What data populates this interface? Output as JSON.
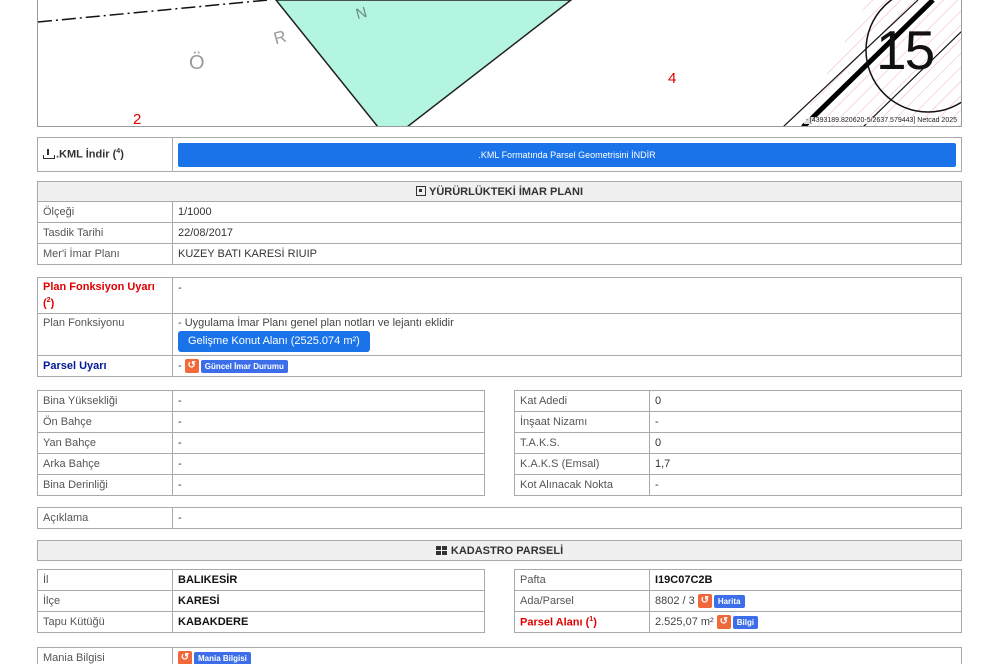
{
  "map": {
    "labels": {
      "o": "Ö",
      "r": "R",
      "n": "N",
      "parcel_2": "2",
      "parcel_4": "4",
      "sheet": "15"
    },
    "attribution": "- [4393189.820620-5/2637.579443] Netcad 2025",
    "colors": {
      "parcel_fill": "#b3f5e1",
      "hatch": "#f3b1b1"
    }
  },
  "kml": {
    "label": ".KML İndir (",
    "label_sup": "4",
    "label_end": ")",
    "button": ".KML Formatında Parsel Geometrisini İNDİR"
  },
  "imar": {
    "title": "YÜRÜRLÜKTEKİ İMAR PLANI",
    "rows": [
      {
        "label": "Ölçeği",
        "value": "1/1000"
      },
      {
        "label": "Tasdik Tarihi",
        "value": "22/08/2017"
      },
      {
        "label": "Mer'i İmar Planı",
        "value": "KUZEY BATI KARESİ RIUIP"
      }
    ]
  },
  "fonksiyon": {
    "warn_label": "Plan Fonksiyon Uyarı (",
    "warn_sup": "2",
    "warn_end": ")",
    "warn_value": "-",
    "label": "Plan Fonksiyonu",
    "note": "- Uygulama İmar Planı genel plan notları ve lejantı eklidir",
    "button": "Gelişme Konut Alanı (2525.074 m²)",
    "parsel_label": "Parsel Uyarı",
    "parsel_dash": "-",
    "parsel_button": "Güncel İmar Durumu"
  },
  "yapi_left": [
    {
      "label": "Bina Yüksekliği",
      "value": "-"
    },
    {
      "label": "Ön Bahçe",
      "value": "-"
    },
    {
      "label": "Yan Bahçe",
      "value": "-"
    },
    {
      "label": "Arka Bahçe",
      "value": "-"
    },
    {
      "label": "Bina Derinliği",
      "value": "-"
    }
  ],
  "yapi_right": [
    {
      "label": "Kat Adedi",
      "value": "0"
    },
    {
      "label": "İnşaat Nizamı",
      "value": "-"
    },
    {
      "label": "T.A.K.S.",
      "value": "0"
    },
    {
      "label": "K.A.K.S (Emsal)",
      "value": "1,7"
    },
    {
      "label": "Kot Alınacak Nokta",
      "value": "-"
    }
  ],
  "aciklama": {
    "label": "Açıklama",
    "value": "-"
  },
  "kadastro": {
    "title": "KADASTRO PARSELİ",
    "left": [
      {
        "label": "İl",
        "value": "BALIKESİR"
      },
      {
        "label": "İlçe",
        "value": "KARESİ"
      },
      {
        "label": "Tapu Kütüğü",
        "value": "KABAKDERE"
      }
    ],
    "pafta_label": "Pafta",
    "pafta_value": "I19C07C2B",
    "ada_label": "Ada/Parsel",
    "ada_value": "8802 / 3",
    "ada_button": "Harita",
    "alan_label": "Parsel Alanı (",
    "alan_sup": "1",
    "alan_end": ")",
    "alan_value": "2.525,07 m²",
    "alan_button": "Bilgi"
  },
  "mania": {
    "label": "Mania Bilgisi",
    "button": "Mania Bilgisi"
  },
  "colors": {
    "primary": "#1a73e8",
    "warning_red": "#e00000",
    "dark_blue": "#001a99",
    "tag_orange": "#f1683a"
  }
}
